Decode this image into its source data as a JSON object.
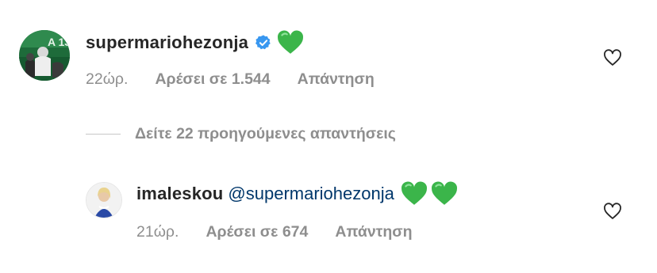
{
  "comments": [
    {
      "username": "supermariohezonja",
      "verified": true,
      "verified_icon": "verified-badge-icon",
      "text_emojis": [
        "green-heart-emoji"
      ],
      "time": "22ώρ.",
      "likes": "Αρέσει σε 1.544",
      "reply": "Απάντηση"
    },
    {
      "username": "imaleskou",
      "mention": "@supermariohezonja",
      "text_emojis": [
        "green-heart-emoji",
        "green-heart-emoji"
      ],
      "time": "21ώρ.",
      "likes": "Αρέσει σε 674",
      "reply": "Απάντηση"
    }
  ],
  "view_previous_replies": "Δείτε 22 προηγούμενες απαντήσεις",
  "colors": {
    "text": "#262626",
    "meta": "#8e8e8e",
    "mention": "#00376b",
    "verified": "#3897f0",
    "green_heart": "#3bb54a"
  }
}
